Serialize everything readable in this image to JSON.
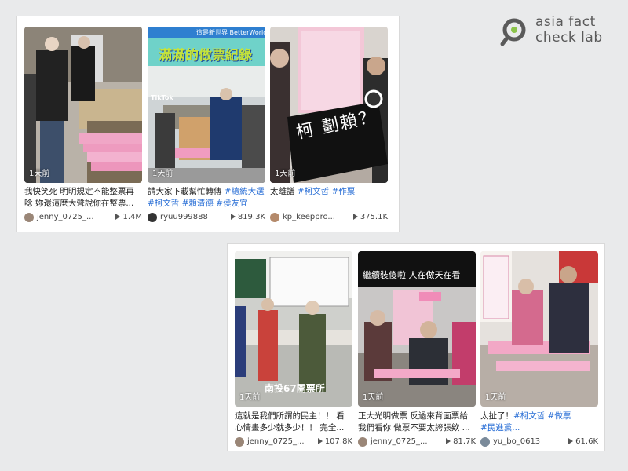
{
  "brand": {
    "line1": "asia fact",
    "line2": "check lab"
  },
  "top_panel": [
    {
      "time": "1天前",
      "caption_line1": "我快笑死 明明規定不能整票再",
      "caption_line2": "唸 妳還這麼大聲說你在整票...",
      "user": "jenny_0725_...",
      "views": "1.4M"
    },
    {
      "time": "1天前",
      "overlay_top": "這是新世界 BetterWorld",
      "overlay_title": "滿滿的做票紀錄",
      "overlay_tiktok": "TikTok",
      "caption_pre": "請大家下載幫忙轉傳 ",
      "caption_tag1": "#總統大選",
      "caption_tags2": "#柯文哲 #賴清德 #侯友宜",
      "user": "ryuu999888",
      "views": "819.3K"
    },
    {
      "time": "1天前",
      "overlay_text": "柯 劃賴？",
      "caption_pre": "太離譜 ",
      "caption_tags": "#柯文哲 #作票",
      "user": "kp_keeppro...",
      "views": "375.1K"
    }
  ],
  "bottom_panel": [
    {
      "time": "1天前",
      "overlay_text": "南投67開票所",
      "caption_line1": "這就是我們所謂的民主！！ 看",
      "caption_line2": "心情畫多少就多少！！ 完全...",
      "user": "jenny_0725_...",
      "views": "107.8K"
    },
    {
      "time": "1天前",
      "overlay_text": "繼續裝傻啦 人在做天在看",
      "caption_line1": "正大光明做票 反過來背面票給",
      "caption_line2": "我們看你 做票不要太誇張欸 ...",
      "user": "jenny_0725_...",
      "views": "81.7K"
    },
    {
      "time": "1天前",
      "caption_pre": "太扯了！",
      "caption_tags1": "#柯文哲 #做票",
      "caption_tags2": "#民進黨...",
      "user": "yu_bo_0613",
      "views": "61.6K"
    }
  ]
}
